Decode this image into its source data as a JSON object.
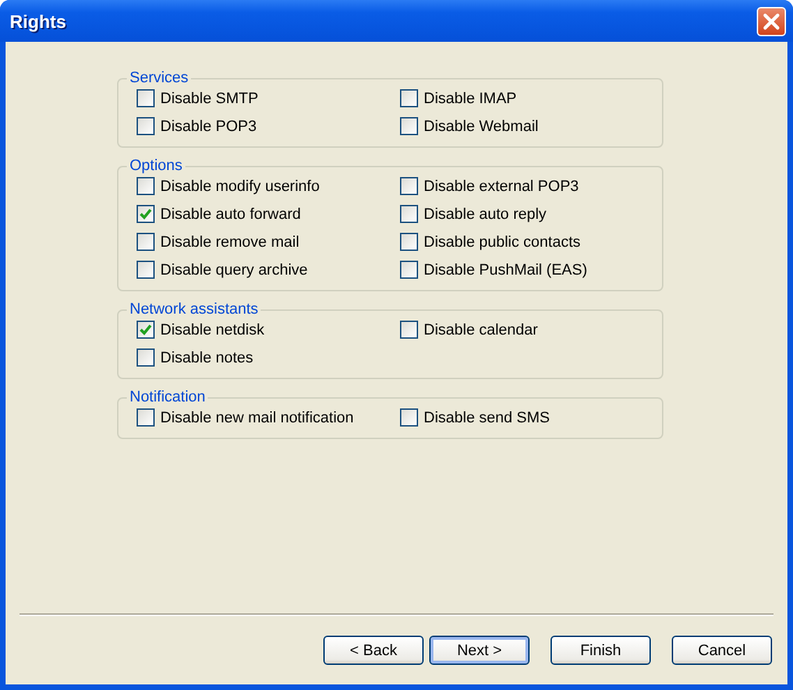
{
  "window": {
    "title": "Rights"
  },
  "groups": [
    {
      "title": "Services",
      "items": [
        {
          "label": "Disable SMTP",
          "checked": false
        },
        {
          "label": "Disable IMAP",
          "checked": false
        },
        {
          "label": "Disable POP3",
          "checked": false
        },
        {
          "label": "Disable Webmail",
          "checked": false
        }
      ]
    },
    {
      "title": "Options",
      "items": [
        {
          "label": "Disable modify userinfo",
          "checked": false
        },
        {
          "label": "Disable external POP3",
          "checked": false
        },
        {
          "label": "Disable auto forward",
          "checked": true
        },
        {
          "label": "Disable auto reply",
          "checked": false
        },
        {
          "label": "Disable remove mail",
          "checked": false
        },
        {
          "label": "Disable public contacts",
          "checked": false
        },
        {
          "label": "Disable query archive",
          "checked": false
        },
        {
          "label": "Disable PushMail (EAS)",
          "checked": false
        }
      ]
    },
    {
      "title": "Network assistants",
      "items": [
        {
          "label": "Disable netdisk",
          "checked": true
        },
        {
          "label": "Disable calendar",
          "checked": false
        },
        {
          "label": "Disable notes",
          "checked": false
        }
      ]
    },
    {
      "title": "Notification",
      "items": [
        {
          "label": "Disable new mail notification",
          "checked": false
        },
        {
          "label": "Disable send SMS",
          "checked": false
        }
      ]
    }
  ],
  "buttons": [
    {
      "label": "< Back",
      "default": false
    },
    {
      "label": "Next >",
      "default": true
    },
    {
      "label": "Finish",
      "default": false
    },
    {
      "label": "Cancel",
      "default": false
    }
  ]
}
